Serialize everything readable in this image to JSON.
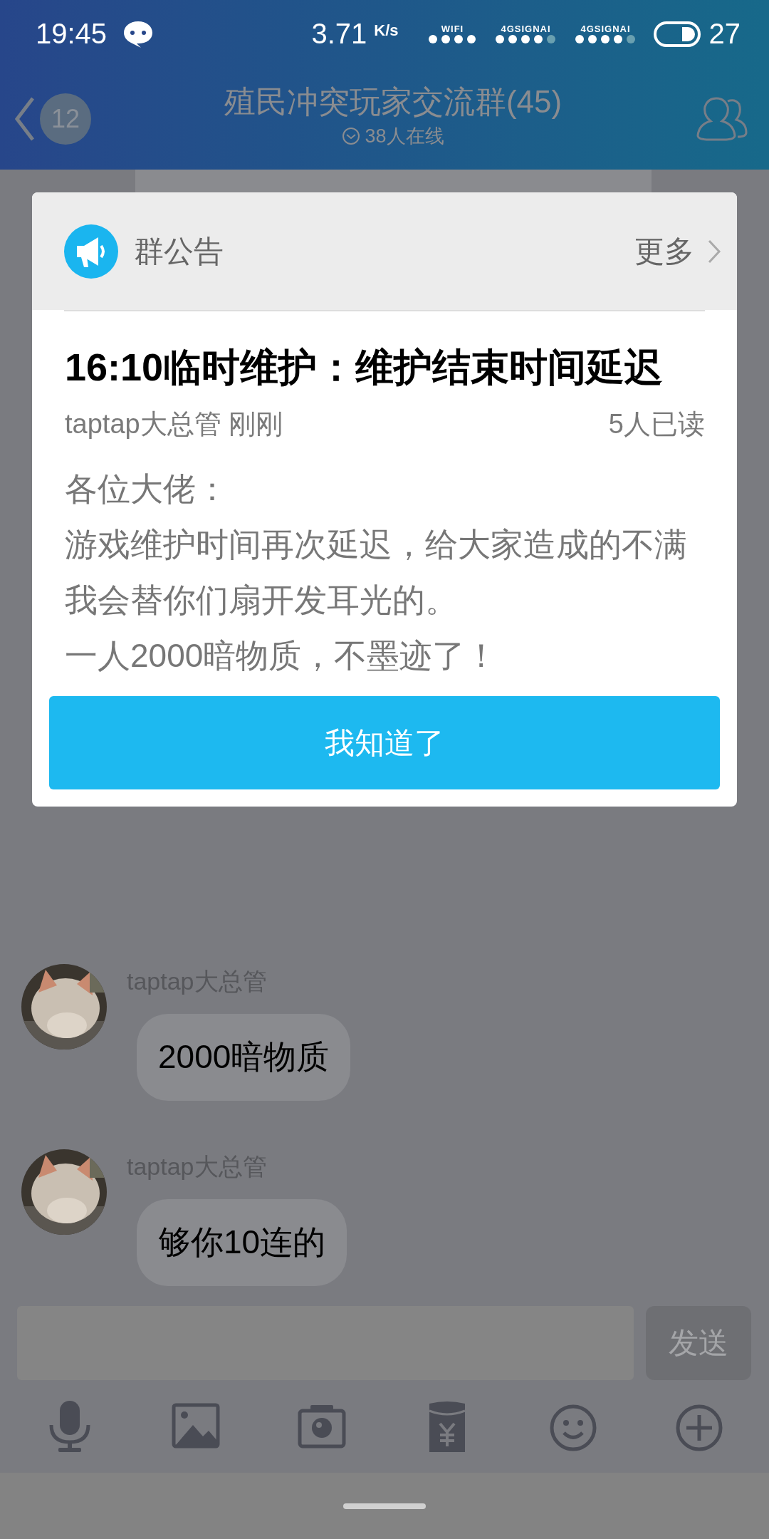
{
  "status_bar": {
    "time": "19:45",
    "speed": "3.71",
    "speed_unit": "K/s",
    "wifi_label": "WIFI",
    "signal_labels": [
      "4GSIGNAI",
      "4GSIGNAI"
    ],
    "battery": "27"
  },
  "header": {
    "badge": "12",
    "title": "殖民冲突玩家交流群(45)",
    "subtitle": "38人在线"
  },
  "chat": {
    "messages": [
      {
        "sender": "taptap大总管",
        "text": "2000暗物质"
      },
      {
        "sender": "taptap大总管",
        "text": "够你10连的"
      }
    ]
  },
  "notice": {
    "heading": "群公告",
    "more": "更多",
    "title": "16:10临时维护：维护结束时间延迟",
    "author": "taptap大总管",
    "time": "刚刚",
    "read_count": "5人已读",
    "body": [
      "各位大佬：",
      "游戏维护时间再次延迟，给大家造成的不满我会替你们扇开发耳光的。",
      "一人2000暗物质，不墨迹了！"
    ],
    "button": "我知道了"
  },
  "input_bar": {
    "send": "发送"
  }
}
